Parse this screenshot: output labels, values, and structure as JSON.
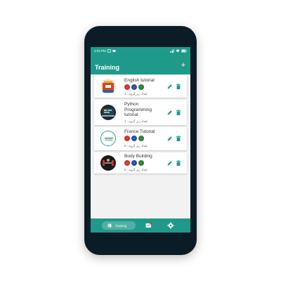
{
  "status_bar": {
    "time": "2:03 PM"
  },
  "app_bar": {
    "title": "Training",
    "add_label": "+"
  },
  "colors": {
    "primary": "#1f9a8a",
    "badge_red": "#d32f2f",
    "badge_blue": "#1e4fa8",
    "badge_green": "#2e7d32",
    "frame": "#0c1c26"
  },
  "courses": [
    {
      "title": "English tutorial",
      "subtitle": "تعداد زیر گروه : 1",
      "badges": [
        "•",
        "•",
        "•"
      ],
      "thumb": "english-book-icon"
    },
    {
      "title": "Python Programming tutorial",
      "subtitle": "تعداد زیر گروه : 1",
      "badges": [],
      "thumb": "python-laptop-icon"
    },
    {
      "title": "France Tutorial",
      "subtitle": "تعداد زیر گروه : 0",
      "badges": [
        "•",
        "•",
        "•"
      ],
      "thumb": "france-logo-icon"
    },
    {
      "title": "Body Building",
      "subtitle": "تعداد زیر گروه : 0",
      "badges": [
        "•",
        "•",
        "•"
      ],
      "thumb": "gym-icon"
    }
  ],
  "bottom_nav": {
    "training_label": "Training"
  }
}
